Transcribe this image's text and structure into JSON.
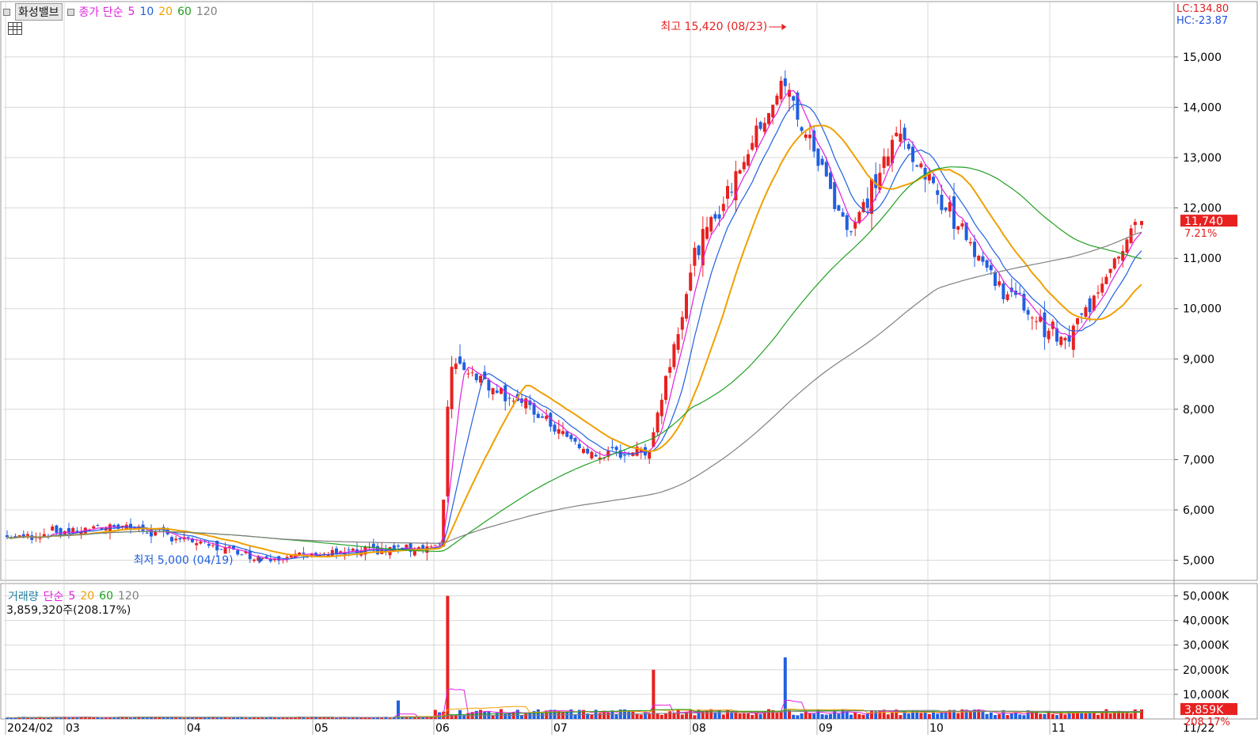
{
  "header": {
    "stock_name": "화성밸브",
    "ma_label": "종가 단순",
    "ma_periods": [
      "5",
      "10",
      "20",
      "60",
      "120"
    ],
    "ma_colors": [
      "#e020e0",
      "#2060e0",
      "#f0a000",
      "#20a020",
      "#808080"
    ],
    "lc": "LC:134.80",
    "hc": "HC:-23.87"
  },
  "volume_header": {
    "label": "거래량",
    "ma_label": "단순",
    "ma_periods": [
      "5",
      "20",
      "60",
      "120"
    ],
    "ma_colors": [
      "#e020e0",
      "#f0a000",
      "#20a020",
      "#808080"
    ],
    "current": "3,859,320주(208.17%)"
  },
  "price_axis": {
    "ticks": [
      5000,
      6000,
      7000,
      8000,
      9000,
      10000,
      11000,
      12000,
      13000,
      14000,
      15000
    ],
    "tick_labels": [
      "5,000",
      "6,000",
      "7,000",
      "8,000",
      "9,000",
      "10,000",
      "11,000",
      "12,000",
      "13,000",
      "14,000",
      "15,000"
    ],
    "range": [
      4600,
      16100
    ]
  },
  "volume_axis": {
    "ticks": [
      10000,
      20000,
      30000,
      40000,
      50000
    ],
    "tick_labels": [
      "10,000K",
      "20,000K",
      "30,000K",
      "40,000K",
      "50,000K"
    ],
    "range": [
      0,
      55000
    ]
  },
  "annotations": {
    "high": "최고 15,420 (08/23)",
    "low": "최저 5,000 (04/19)"
  },
  "last_price": {
    "price": "11,740",
    "change": "7.21%"
  },
  "last_volume": {
    "volume": "3,859K",
    "ratio": "208.17%"
  },
  "x_labels": [
    "2024/02",
    "03",
    "04",
    "05",
    "06",
    "07",
    "08",
    "09",
    "10",
    "11",
    "11/22"
  ],
  "colors": {
    "up": "#e82020",
    "down": "#2060e0",
    "grid": "#d8d8d8",
    "price_tag": "#e82020"
  },
  "chart_data": {
    "type": "candlestick",
    "title": "화성밸브",
    "months": [
      "2024/02",
      "03",
      "04",
      "05",
      "06",
      "07",
      "08",
      "09",
      "10",
      "11"
    ],
    "price_anchors": {
      "dates": [
        "02/05",
        "03/15",
        "04/19",
        "05/20",
        "06/03",
        "06/05",
        "06/20",
        "07/10",
        "07/22",
        "08/02",
        "08/23",
        "09/10",
        "09/23",
        "10/18",
        "11/05",
        "11/22"
      ],
      "close": [
        5450,
        5700,
        5050,
        5200,
        5300,
        9000,
        8300,
        7050,
        7200,
        11000,
        14500,
        11500,
        13500,
        10500,
        9300,
        11740
      ]
    },
    "high": 15420,
    "low": 5000,
    "last_close": 11740,
    "change_pct": 7.21,
    "volume_peaks_k": [
      {
        "date": "05/22",
        "volume": 7500
      },
      {
        "date": "06/05",
        "volume": 50000
      },
      {
        "date": "07/23",
        "volume": 20000
      },
      {
        "date": "08/23",
        "volume": 25000
      },
      {
        "date": "11/22",
        "volume": 3859
      }
    ],
    "series": [
      {
        "name": "5"
      },
      {
        "name": "10"
      },
      {
        "name": "20"
      },
      {
        "name": "60"
      },
      {
        "name": "120"
      }
    ]
  }
}
